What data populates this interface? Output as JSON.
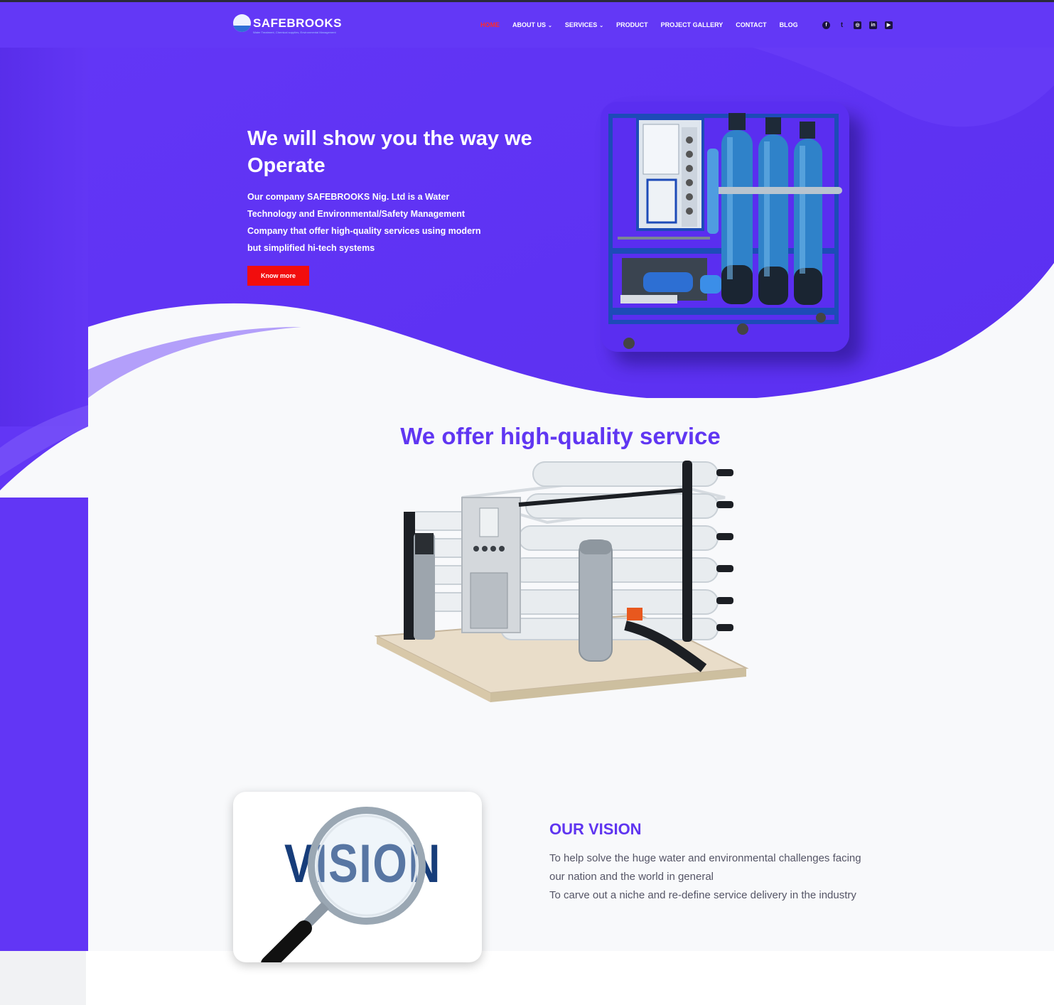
{
  "brand": {
    "name": "SAFEBROOKS",
    "tagline": "Water Treatment, Chemical supplies, Environmental Management"
  },
  "nav": {
    "items": [
      {
        "label": "HOME",
        "active": true,
        "has_dropdown": false
      },
      {
        "label": "ABOUT US",
        "active": false,
        "has_dropdown": true
      },
      {
        "label": "SERVICES",
        "active": false,
        "has_dropdown": true
      },
      {
        "label": "PRODUCT",
        "active": false,
        "has_dropdown": false
      },
      {
        "label": "PROJECT GALLERY",
        "active": false,
        "has_dropdown": false
      },
      {
        "label": "CONTACT",
        "active": false,
        "has_dropdown": false
      },
      {
        "label": "BLOG",
        "active": false,
        "has_dropdown": false
      }
    ],
    "caret": "⌄",
    "socials": [
      {
        "icon": "facebook-icon",
        "glyph": "f"
      },
      {
        "icon": "twitter-icon",
        "glyph": "t"
      },
      {
        "icon": "instagram-icon",
        "glyph": "◎"
      },
      {
        "icon": "linkedin-icon",
        "glyph": "in"
      },
      {
        "icon": "youtube-icon",
        "glyph": "▶"
      }
    ]
  },
  "hero": {
    "title": "We will show you the way we Operate",
    "text": "Our company SAFEBROOKS Nig. Ltd is a Water Technology and Environmental/Safety Management Company that offer high-quality services using modern but simplified hi-tech systems",
    "button": "Know more"
  },
  "offer": {
    "title": "We offer high-quality service"
  },
  "vision": {
    "image_word": "VISION",
    "heading": "OUR VISION",
    "lines": [
      "To help solve the huge water and environmental challenges facing our nation and the world in general",
      "To carve out a niche and re-define service delivery in the industry"
    ]
  },
  "colors": {
    "primary": "#6338F6",
    "accent_red": "#F20D0D",
    "heading_purple": "#6036F2",
    "vision_navy": "#173D7A"
  }
}
